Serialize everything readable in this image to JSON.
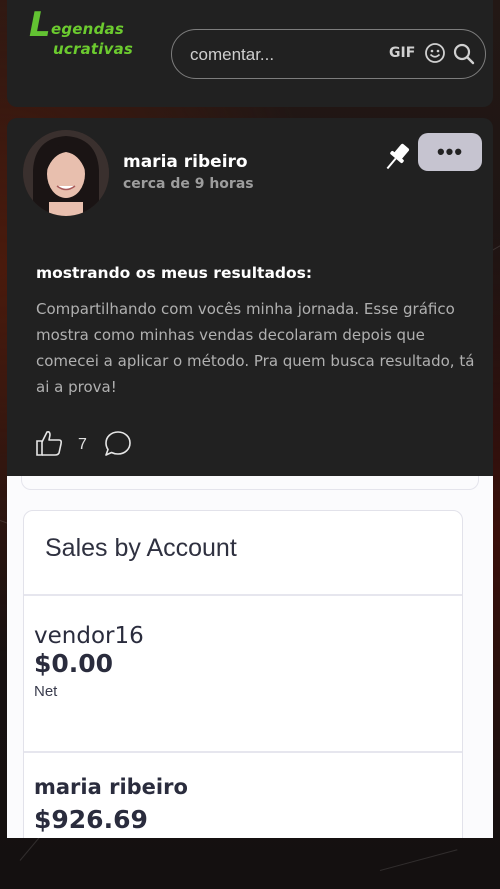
{
  "brand": {
    "logo_initial": "L",
    "logo_line1": "egendas",
    "logo_line2": "ucrativas"
  },
  "search": {
    "placeholder": "comentar...",
    "gif_label": "GIF"
  },
  "post": {
    "author": "maria ribeiro",
    "time": "cerca de 9 horas",
    "more_label": "•••",
    "title": "mostrando os meus resultados:",
    "body": "Compartilhando com vocês minha jornada. Esse gráfico mostra como minhas vendas decolaram depois que comecei a aplicar o método. Pra quem busca resultado, tá ai a prova!",
    "likes": "7"
  },
  "attachment": {
    "card_title": "Sales by Account",
    "accounts": [
      {
        "name": "vendor16",
        "amount": "$0.00",
        "label": "Net"
      },
      {
        "name": "maria ribeiro",
        "amount": "$926.69"
      }
    ]
  },
  "colors": {
    "brand_green": "#6ccb2f",
    "card_bg": "#212121",
    "more_button": "#c6c4d0"
  },
  "icons": [
    "emoji-icon",
    "search-icon",
    "pin-icon",
    "like-icon",
    "comment-icon"
  ]
}
